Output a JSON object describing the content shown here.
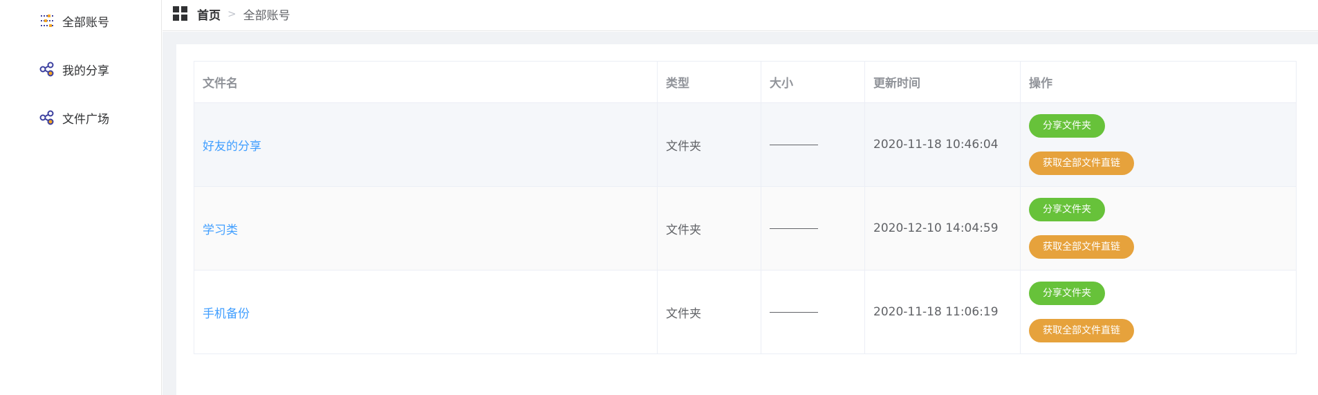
{
  "sidebar": {
    "items": [
      {
        "label": "全部账号",
        "icon": "sliders-icon"
      },
      {
        "label": "我的分享",
        "icon": "share-icon"
      },
      {
        "label": "文件广场",
        "icon": "share-icon"
      }
    ]
  },
  "breadcrumb": {
    "home": "首页",
    "separator": ">",
    "current": "全部账号"
  },
  "table": {
    "columns": [
      "文件名",
      "类型",
      "大小",
      "更新时间",
      "操作"
    ],
    "rows": [
      {
        "name": "好友的分享",
        "type": "文件夹",
        "size": "————",
        "updated": "2020-11-18 10:46:04"
      },
      {
        "name": "学习类",
        "type": "文件夹",
        "size": "————",
        "updated": "2020-12-10 14:04:59"
      },
      {
        "name": "手机备份",
        "type": "文件夹",
        "size": "————",
        "updated": "2020-11-18 11:06:19"
      }
    ],
    "actions": {
      "share_label": "分享文件夹",
      "link_label": "获取全部文件直链"
    }
  },
  "colors": {
    "link": "#409eff",
    "share_button": "#67c23a",
    "link_button": "#e6a23c"
  }
}
